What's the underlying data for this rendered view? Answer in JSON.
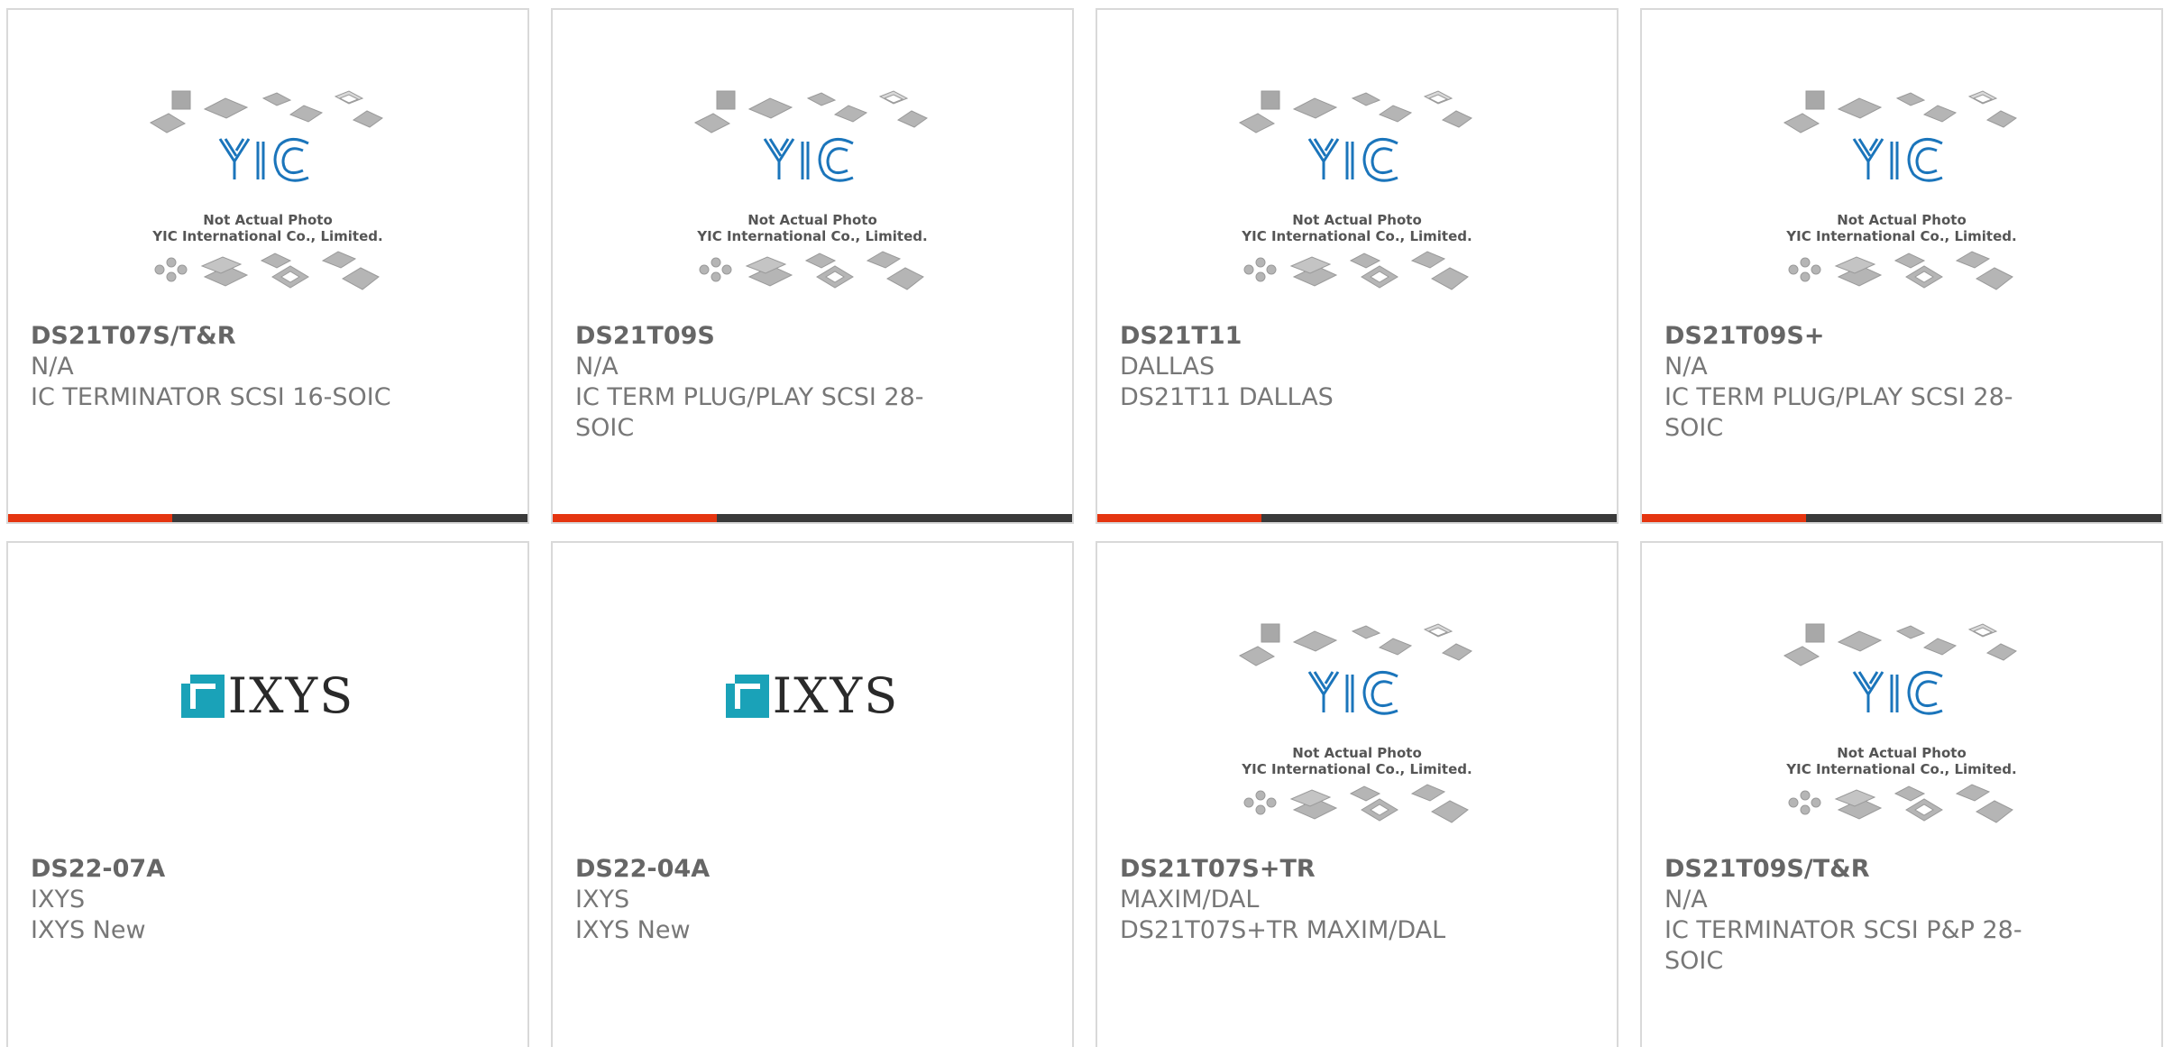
{
  "placeholder": {
    "line1": "Not Actual Photo",
    "line2": "YIC International Co., Limited.",
    "logo_text": "YIC"
  },
  "colors": {
    "accent": "#e53510",
    "bar": "#3a3a3a",
    "ixys_teal": "#1aa2b8",
    "yic_blue": "#1b75bb"
  },
  "products": [
    {
      "part": "DS21T07S/T&R",
      "mfr": "N/A",
      "desc": "IC TERMINATOR SCSI 16-SOIC",
      "image": "yic-placeholder"
    },
    {
      "part": "DS21T09S",
      "mfr": "N/A",
      "desc": "IC TERM PLUG/PLAY SCSI 28-SOIC",
      "image": "yic-placeholder"
    },
    {
      "part": "DS21T11",
      "mfr": "DALLAS",
      "desc": "DS21T11 DALLAS",
      "image": "yic-placeholder"
    },
    {
      "part": "DS21T09S+",
      "mfr": "N/A",
      "desc": "IC TERM PLUG/PLAY SCSI 28-SOIC",
      "image": "yic-placeholder"
    },
    {
      "part": "DS22-07A",
      "mfr": "IXYS",
      "desc": "IXYS New",
      "image": "ixys-logo",
      "logo_text": "IXYS"
    },
    {
      "part": "DS22-04A",
      "mfr": "IXYS",
      "desc": "IXYS New",
      "image": "ixys-logo",
      "logo_text": "IXYS"
    },
    {
      "part": "DS21T07S+TR",
      "mfr": "MAXIM/DAL",
      "desc": "DS21T07S+TR MAXIM/DAL",
      "image": "yic-placeholder"
    },
    {
      "part": "DS21T09S/T&R",
      "mfr": "N/A",
      "desc": "IC TERMINATOR SCSI P&P 28-SOIC",
      "image": "yic-placeholder"
    }
  ]
}
